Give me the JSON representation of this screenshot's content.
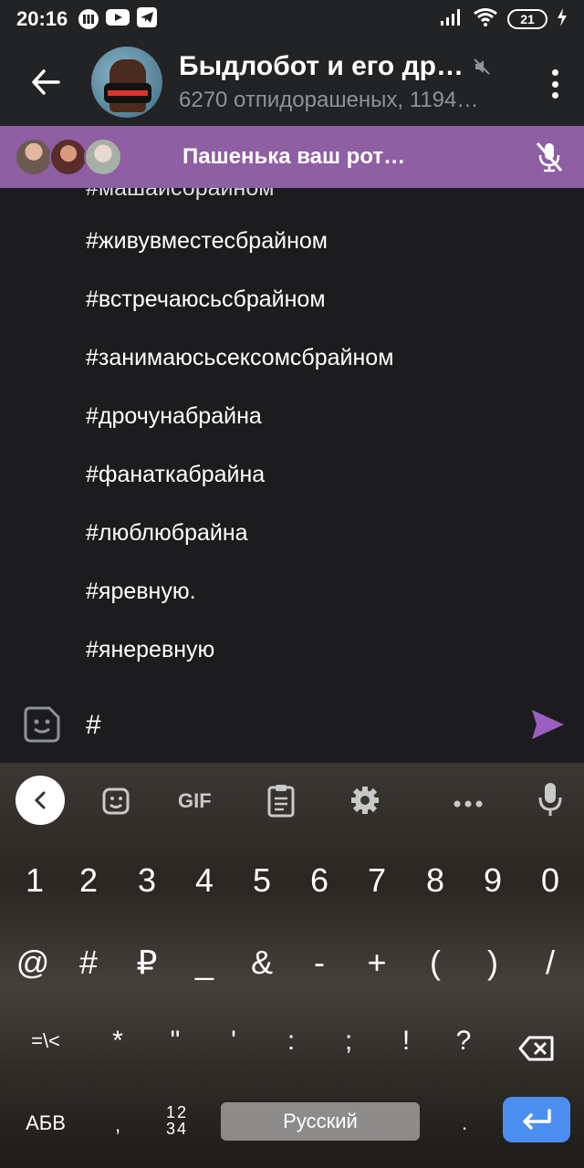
{
  "status_bar": {
    "time": "20:16",
    "battery": "21",
    "icons": [
      "record-icon",
      "youtube-icon",
      "telegram-icon",
      "signal-icon",
      "wifi-icon",
      "battery-icon",
      "charging-icon"
    ]
  },
  "header": {
    "title": "Быдлобот и его др…",
    "subtitle": "6270 отпидорашеных, 1194…",
    "muted": true
  },
  "voice_chat": {
    "title": "Пашенька ваш рот…",
    "participants_count": 3
  },
  "messages": [
    "#живувместесбрайном",
    "#встречаюсьсбрайном",
    "#занимаюсьсексомсбрайном",
    "#дрочунабрайна",
    "#фанаткабрайна",
    "#люблюбрайна",
    "#яревную.",
    "#янеревную"
  ],
  "input": {
    "value": "#"
  },
  "keyboard": {
    "toolbar": {
      "gif_label": "GIF"
    },
    "row_numbers": [
      "1",
      "2",
      "3",
      "4",
      "5",
      "6",
      "7",
      "8",
      "9",
      "0"
    ],
    "row_symbols1": [
      "@",
      "#",
      "₽",
      "_",
      "&",
      "-",
      "+",
      "(",
      ")",
      "/"
    ],
    "row_symbols2": [
      "=\\<",
      "*",
      "\"",
      "'",
      ":",
      ";",
      "!",
      "?"
    ],
    "abc_label": "АБВ",
    "comma": ",",
    "num_label_top": "12",
    "num_label_bottom": "34",
    "space_label": "Русский",
    "period": "."
  },
  "colors": {
    "background": "#1c1c1e",
    "header": "#222325",
    "voice_bar": "#8e5fa3",
    "send": "#9a5fc0",
    "enter_key": "#4b8ef0"
  }
}
